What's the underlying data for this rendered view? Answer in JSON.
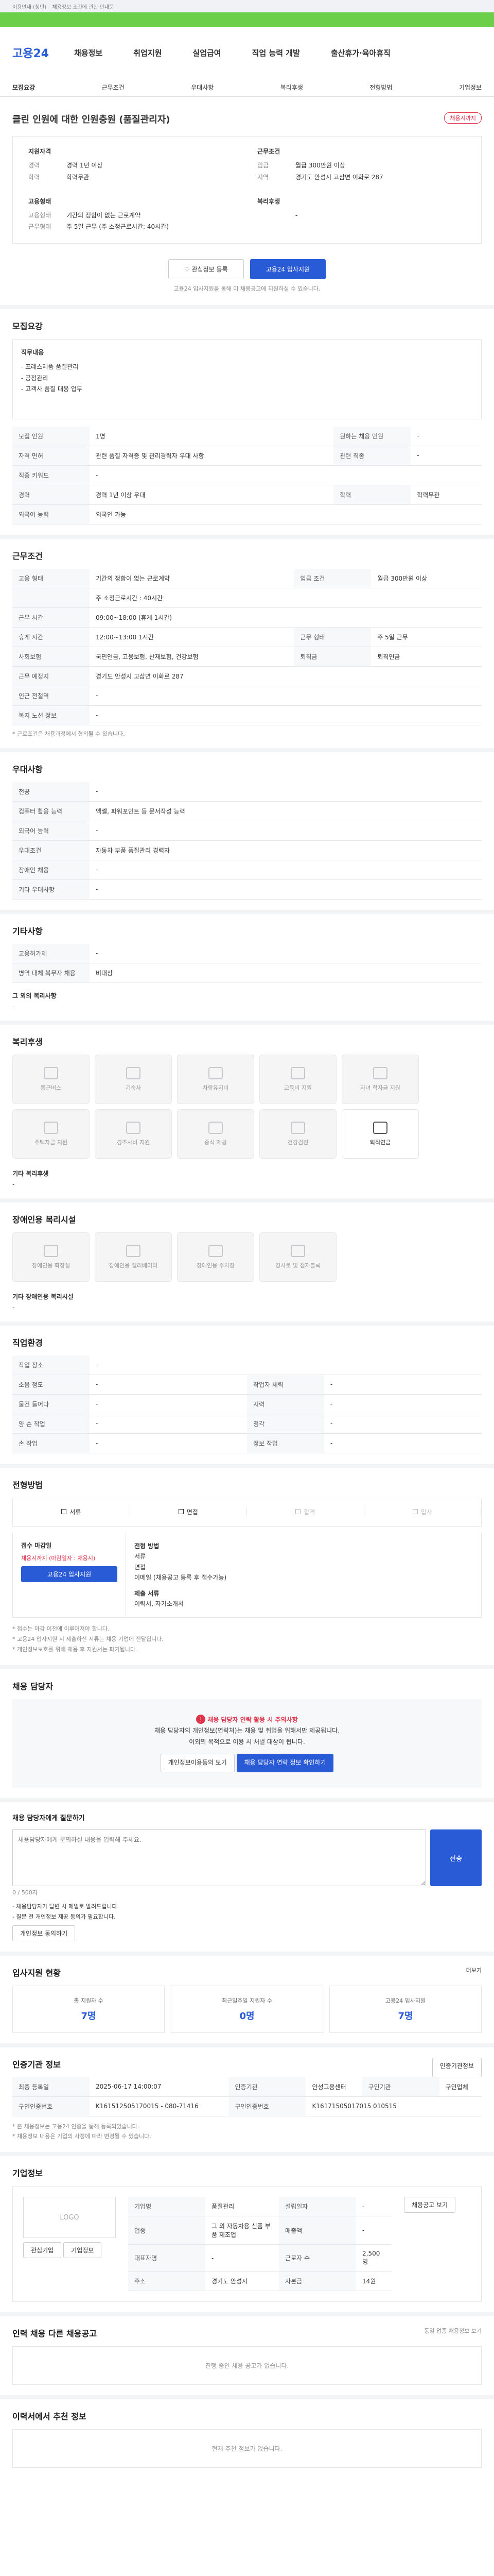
{
  "banner": {
    "left": "이용안내 (청년)",
    "text": "채용정보 조건에 관한 안내문"
  },
  "logo": "고용24",
  "nav": [
    "채용정보",
    "취업지원",
    "실업급여",
    "직업 능력 개발",
    "출산휴가·육아휴직"
  ],
  "tabs": [
    "모집요강",
    "근무조건",
    "우대사항",
    "복리후생",
    "전형방법",
    "기업정보"
  ],
  "title": "클린 인원에 대한 인원충원 (품질관리자)",
  "title_badge": "채용시까지",
  "summary_left": {
    "heading": "지원자격",
    "rows": [
      {
        "k": "경력",
        "v": "경력 1년 이상"
      },
      {
        "k": "학력",
        "v": "학력무관"
      }
    ]
  },
  "summary_right": {
    "heading": "근무조건",
    "rows": [
      {
        "k": "임금",
        "v": "월급 300만원 이상"
      },
      {
        "k": "지역",
        "v": "경기도 안성시 고삼면 이화로 287"
      }
    ]
  },
  "summary_left2": {
    "heading": "고용형태",
    "rows": [
      {
        "k": "고용형태",
        "v": "기간의 정함이 없는 근로계약"
      },
      {
        "k": "근무형태",
        "v": "주 5일 근무 (주 소정근로시간: 40시간)"
      }
    ]
  },
  "summary_right2": {
    "heading": "복리후생",
    "rows": [
      {
        "k": "",
        "v": "-"
      }
    ]
  },
  "actions": {
    "save": "관심정보 등록",
    "apply": "고용24 입사지원"
  },
  "notice_small": "고용24 입사지원을 통해 이 채용공고에 지원하실 수 있습니다.",
  "recruit": {
    "title": "모집요강",
    "duty_heading": "직무내용",
    "duties": [
      "- 프레스제품 품질관리",
      "- 공정관리",
      "- 고객사 품질 대응 업무"
    ],
    "rows": [
      {
        "k": "모집 인원",
        "v": "1명",
        "k2": "원하는 채용 인원",
        "v2": "-"
      },
      {
        "k": "자격 면허",
        "v": "관련 품질 자격증 및 관리경력자 우대 사항",
        "k2": "관련 직종",
        "v2": "-"
      },
      {
        "k": "직종 키워드",
        "v": "-",
        "k2": "",
        "v2": ""
      },
      {
        "k": "경력",
        "v": "경력 1년 이상 우대",
        "k2": "학력",
        "v2": "학력무관"
      },
      {
        "k": "외국어 능력",
        "v": "외국인 가능",
        "k2": "",
        "v2": ""
      }
    ]
  },
  "work": {
    "title": "근무조건",
    "rows": [
      {
        "k": "고용 형태",
        "v": "기간의 정함이 없는 근로계약",
        "k2": "임금 조건",
        "v2": "월급 300만원 이상"
      },
      {
        "k": "",
        "v": "주 소정근로시간 : 40시간",
        "k2": "",
        "v2": ""
      },
      {
        "k": "근무 시간",
        "v": "09:00~18:00 (휴게 1시간)",
        "k2": "",
        "v2": ""
      },
      {
        "k": "휴게 시간",
        "v": "12:00~13:00 1시간",
        "k2": "근무 형태",
        "v2": "주 5일 근무"
      },
      {
        "k": "사회보험",
        "v": "국민연금, 고용보험, 산재보험, 건강보험",
        "k2": "퇴직금",
        "v2": "퇴직연금"
      },
      {
        "k": "근무 예정지",
        "v": "경기도 안성시 고삼면 이화로 287",
        "k2": "",
        "v2": ""
      },
      {
        "k": "인근 전철역",
        "v": "-",
        "k2": "",
        "v2": ""
      },
      {
        "k": "복지 노선 정보",
        "v": "-",
        "k2": "",
        "v2": ""
      }
    ],
    "note": "* 근로조건은 채용과정에서 협의될 수 있습니다."
  },
  "pref": {
    "title": "우대사항",
    "rows": [
      {
        "k": "전공",
        "v": "-"
      },
      {
        "k": "컴퓨터 활용 능력",
        "v": "엑셀, 파워포인트 등 문서작성 능력"
      },
      {
        "k": "외국어 능력",
        "v": "-"
      },
      {
        "k": "우대조건",
        "v": "자동차 부품 품질관리 경력자"
      },
      {
        "k": "장애인 채용",
        "v": "-"
      },
      {
        "k": "기타 우대사항",
        "v": "-"
      }
    ]
  },
  "etc": {
    "title": "기타사항",
    "rows": [
      {
        "k": "고용허가제",
        "v": "-"
      },
      {
        "k": "병역 대체 복무자 채용",
        "v": "비대상"
      }
    ],
    "extra_title": "그 외의 복리사항",
    "extra_value": "-"
  },
  "welfare": {
    "title": "복리후생",
    "tiles": [
      {
        "label": "통근버스",
        "on": false
      },
      {
        "label": "기숙사",
        "on": false
      },
      {
        "label": "차량유지비",
        "on": false
      },
      {
        "label": "교육비 지원",
        "on": false
      },
      {
        "label": "자녀 학자금 지원",
        "on": false
      },
      {
        "label": "주택자금 지원",
        "on": false
      },
      {
        "label": "경조사비 지원",
        "on": false
      },
      {
        "label": "중식 제공",
        "on": false
      },
      {
        "label": "건강검진",
        "on": false
      },
      {
        "label": "퇴직연금",
        "on": true
      }
    ],
    "other_title": "기타 복리후생",
    "other_value": "-"
  },
  "disabled_fac": {
    "title": "장애인용 복리시설",
    "tiles": [
      {
        "label": "장애인용 화장실"
      },
      {
        "label": "장애인용 엘리베이터"
      },
      {
        "label": "장애인용 주차장"
      },
      {
        "label": "경사로 및 점자블록"
      }
    ],
    "other_title": "기타 장애인용 복리시설",
    "other_value": "-"
  },
  "workplace": {
    "title": "직업환경",
    "rows": [
      {
        "k": "작업 장소",
        "v": "-",
        "k2": "",
        "v2": ""
      },
      {
        "k": "소음 정도",
        "v": "-",
        "k2": "작업자 체력",
        "v2": "-"
      },
      {
        "k": "물건 들어다",
        "v": "-",
        "k2": "시력",
        "v2": "-"
      },
      {
        "k": "양 손 작업",
        "v": "-",
        "k2": "청각",
        "v2": "-"
      },
      {
        "k": "손 작업",
        "v": "-",
        "k2": "정보 작업",
        "v2": "-"
      }
    ]
  },
  "process": {
    "title": "전형방법",
    "steps": [
      "서류",
      "면접",
      "합격",
      "입사"
    ],
    "deadline_label": "접수 마감일",
    "deadline": "채용시까지 (마감일자 : 채용시)",
    "apply_btn": "고용24 입사지원",
    "method_title": "전형 방법",
    "method": "서류\n면접\n이메일 (채용공고 등록 후 접수가능)",
    "docs_title": "제출 서류",
    "docs": "이력서, 자기소개서",
    "notes": [
      "* 접수는 마감 이전에 이루어져야 합니다.",
      "* 고용24 입사지원 시 제출하신 서류는 채용 기업에 전달됩니다.",
      "* 개인정보보호를 위해 채용 후 지원서는 파기됩니다."
    ]
  },
  "contact": {
    "title": "채용 담당자",
    "alert_title": "채용 담당자 연락 활용 시 주의사항",
    "alert_text": "채용 담당자의 개인정보(연락처)는 채용 및 취업을 위해서만 제공됩니다.",
    "alert_text2": "이외의 목적으로 이용 시 처벌 대상이 됩니다.",
    "btn1": "개인정보이용동의 보기",
    "btn2": "채용 담당자 연락 정보 확인하기"
  },
  "inquiry": {
    "title": "채용 담당자에게 질문하기",
    "placeholder": "채용담당자에게 문의하실 내용을 입력해 주세요.",
    "count": "0 / 500자",
    "submit": "전송",
    "notes": [
      "- 채용담당자가 답변 시 메일로 알려드립니다.",
      "- 질문 전 개인정보 제공 동의가 필요합니다."
    ],
    "notes_btn": "개인정보 동의하기"
  },
  "stats": {
    "title": "입사지원 현황",
    "link": "더보기",
    "cards": [
      {
        "label": "총 지원자 수",
        "value": "7명"
      },
      {
        "label": "최근일주일 지원자 수",
        "value": "0명"
      },
      {
        "label": "고용24 입사지원",
        "value": "7명"
      }
    ]
  },
  "meta": {
    "title": "인증기관 정보",
    "btn": "인증기관정보",
    "rows": [
      {
        "k": "최종 등록일",
        "v": "2025-06-17 14:00:07",
        "k2": "인증기관",
        "v2": "안성고용센터",
        "k3": "구인기관",
        "v3": "구인업체"
      },
      {
        "k": "구인인증번호",
        "v": "K161512505170015 - 080-71416",
        "k2": "구인인증번호",
        "v2": "K16171505017015 010515",
        "k3": "",
        "v3": ""
      }
    ],
    "notes": [
      "* 본 채용정보는 고용24 인증을 통해 등록되었습니다.",
      "* 채용정보 내용은 기업의 사정에 따라 변경될 수 있습니다."
    ]
  },
  "company": {
    "title": "기업정보",
    "logo_text": "LOGO",
    "btn_a": "관심기업",
    "btn_b": "기업정보",
    "rows": [
      {
        "k": "기업명",
        "v": "품질관리",
        "k2": "설립일자",
        "v2": "-"
      },
      {
        "k": "업종",
        "v": "그 외 자동차용 신품 부품 제조업",
        "k2": "매출액",
        "v2": "-"
      },
      {
        "k": "대표자명",
        "v": "-",
        "k2": "근로자 수",
        "v2": "2,500 명"
      },
      {
        "k": "주소",
        "v": "경기도 안성시",
        "k2": "자본금",
        "v2": "14원"
      }
    ],
    "tag": "기업 정보",
    "more_btn": "채용공고 보기"
  },
  "same_co": {
    "title": "인력 채용 다른 채용공고",
    "empty": "진행 중인 채용 공고가 없습니다.",
    "right": "동일 업종 채용정보 보기"
  },
  "recommend": {
    "title": "이력서에서 추천 정보",
    "empty": "현재 추천 정보가 없습니다."
  }
}
